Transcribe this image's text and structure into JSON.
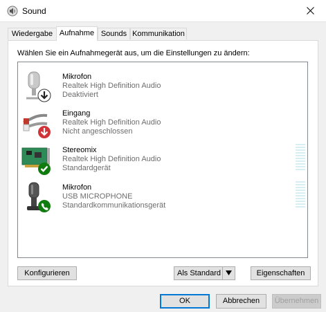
{
  "window": {
    "title": "Sound"
  },
  "tabs": [
    {
      "label": "Wiedergabe",
      "active": false
    },
    {
      "label": "Aufnahme",
      "active": true
    },
    {
      "label": "Sounds",
      "active": false
    },
    {
      "label": "Kommunikation",
      "active": false
    }
  ],
  "instruction": "Wählen Sie ein Aufnahmegerät aus, um die Einstellungen zu ändern:",
  "devices": [
    {
      "name": "Mikrofon",
      "driver": "Realtek High Definition Audio",
      "status": "Deaktiviert",
      "icon": "microphone-icon",
      "badge": "disabled-arrow-badge"
    },
    {
      "name": "Eingang",
      "driver": "Realtek High Definition Audio",
      "status": "Nicht angeschlossen",
      "icon": "line-in-cable-icon",
      "badge": "unplugged-arrow-badge"
    },
    {
      "name": "Stereomix",
      "driver": "Realtek High Definition Audio",
      "status": "Standardgerät",
      "icon": "sound-card-icon",
      "badge": "default-check-badge"
    },
    {
      "name": "Mikrofon",
      "driver": "USB MICROPHONE",
      "status": "Standardkommunikationsgerät",
      "icon": "usb-microphone-icon",
      "badge": "communication-phone-badge"
    }
  ],
  "buttons": {
    "configure": "Konfigurieren",
    "set_default": "Als Standard",
    "properties": "Eigenschaften",
    "ok": "OK",
    "cancel": "Abbrechen",
    "apply": "Übernehmen"
  },
  "colors": {
    "accent": "#0078d7",
    "meter": "#d7eef2",
    "badge_green": "#107c10",
    "badge_red": "#d13438"
  }
}
